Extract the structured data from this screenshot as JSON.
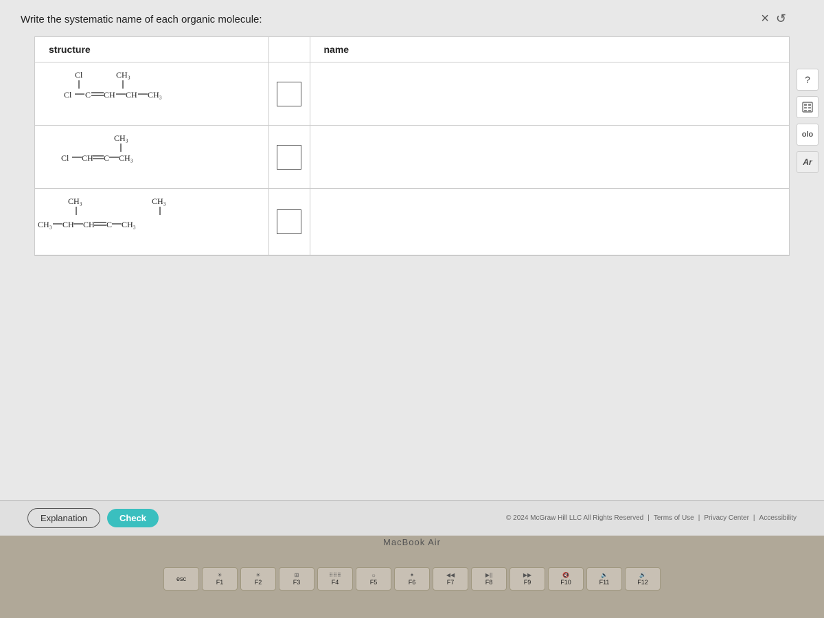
{
  "page": {
    "title": "Write the systematic name of each organic molecule:"
  },
  "table": {
    "headers": {
      "structure": "structure",
      "name": "name"
    },
    "rows": [
      {
        "id": 1,
        "structure_label": "Cl-C=CH-CH-CH3 with Cl and CH3 substituents",
        "name_value": ""
      },
      {
        "id": 2,
        "structure_label": "Cl-CH=C-CH3 with CH3 substituent",
        "name_value": ""
      },
      {
        "id": 3,
        "structure_label": "CH3-CH-CH=C-CH3 with CH3 and CH3 substituents",
        "name_value": ""
      }
    ]
  },
  "buttons": {
    "explanation": "Explanation",
    "check": "Check"
  },
  "footer": {
    "copyright": "© 2024 McGraw Hill LLC All Rights Reserved",
    "terms": "Terms of Use",
    "privacy": "Privacy Center",
    "accessibility": "Accessibility"
  },
  "controls": {
    "close": "×",
    "undo": "↺"
  },
  "icons": {
    "question": "?",
    "calculator": "▦",
    "chart": "olo",
    "ar": "Ar"
  },
  "macbook_label": "MacBook Air",
  "keyboard": {
    "keys": [
      "esc",
      "F1",
      "F2",
      "F3",
      "F4",
      "F5",
      "F6",
      "F7",
      "F8",
      "F9",
      "F10",
      "F11",
      "F12"
    ]
  }
}
